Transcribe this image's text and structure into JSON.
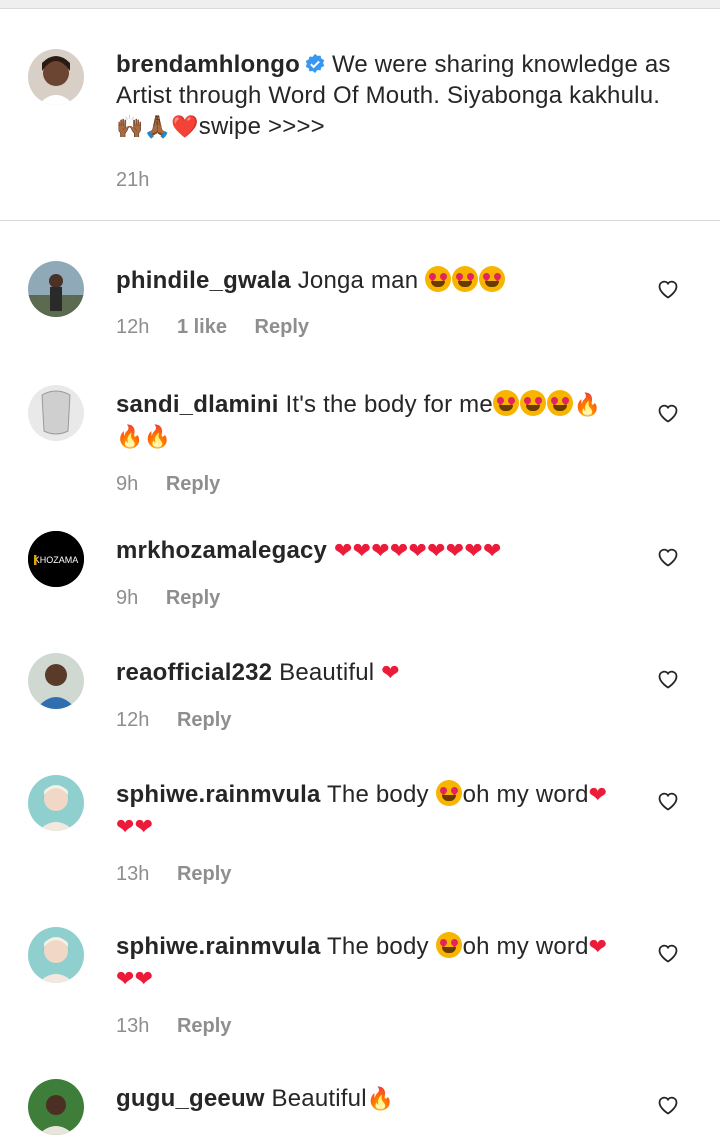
{
  "caption": {
    "username": "brendamhlongo",
    "text_part1": "We were sharing knowledge as",
    "text_part2": "Artist through Word Of Mouth. Siyabonga kakhulu.",
    "text_part3": "swipe >>>>",
    "emoji_prefix": "🙌🏾🙏🏾❤️",
    "time": "21h"
  },
  "colors": {
    "heart": "#ed1b3a",
    "verified": "#3897f0",
    "muted": "#8e8e8e"
  },
  "comments": [
    {
      "username": "phindile_gwala",
      "text": "Jonga man",
      "time": "12h",
      "likes": "1 like",
      "reply": "Reply"
    },
    {
      "username": "sandi_dlamini",
      "text": "It's the body for me",
      "time": "9h",
      "reply": "Reply"
    },
    {
      "username": "mrkhozamalegacy",
      "text": "",
      "time": "9h",
      "reply": "Reply",
      "avatar_text": "KHOZAMA"
    },
    {
      "username": "reaofficial232",
      "text": "Beautiful",
      "time": "12h",
      "reply": "Reply"
    },
    {
      "username": "sphiwe.rainmvula",
      "text_part1": "The body",
      "text_part2": "oh my word",
      "time": "13h",
      "reply": "Reply"
    },
    {
      "username": "sphiwe.rainmvula",
      "text_part1": "The body",
      "text_part2": "oh my word",
      "time": "13h",
      "reply": "Reply"
    },
    {
      "username": "gugu_geeuw",
      "text": "Beautiful",
      "time": "",
      "reply": ""
    }
  ]
}
